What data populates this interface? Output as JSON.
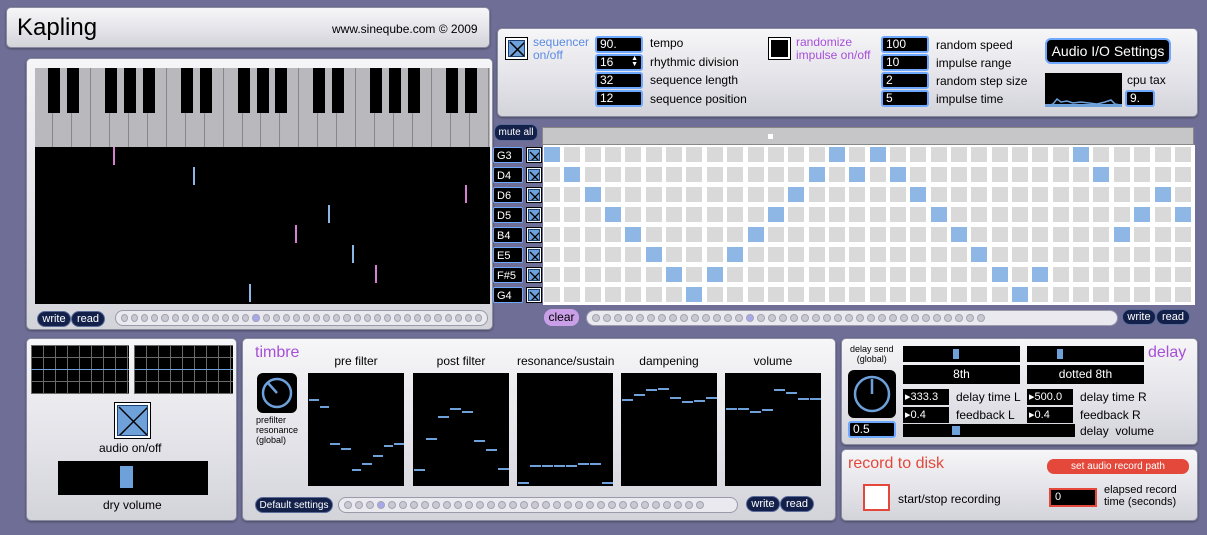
{
  "header": {
    "title": "Kapling",
    "credit": "www.sineqube.com © 2009"
  },
  "keyboard": {
    "white_keys": 24,
    "black_key_pattern": [
      1,
      1,
      0,
      1,
      1,
      1,
      0,
      1,
      1,
      0,
      1,
      1,
      1,
      0,
      1,
      1,
      0,
      1,
      1,
      1,
      0,
      1,
      1,
      0
    ],
    "write_label": "write",
    "read_label": "read",
    "preset_count": 36,
    "preset_selected": 13
  },
  "sequencer": {
    "toggle_label_line1": "sequencer",
    "toggle_label_line2": "on/off",
    "tempo_value": "90.",
    "tempo_label": "tempo",
    "division_value": "16",
    "division_label": "rhythmic division",
    "length_value": "32",
    "length_label": "sequence length",
    "position_value": "12",
    "position_label": "sequence position"
  },
  "randomize": {
    "toggle_label_line1": "randomize",
    "toggle_label_line2": "impulse on/off",
    "speed_value": "100",
    "speed_label": "random speed",
    "range_value": "10",
    "range_label": "impulse range",
    "step_value": "2",
    "step_label": "random step size",
    "time_value": "5",
    "time_label": "impulse time"
  },
  "audio_io": {
    "settings_label": "Audio I/O Settings",
    "cpu_label": "cpu tax",
    "cpu_value": "9."
  },
  "grid": {
    "mute_all_label": "mute all",
    "notes": [
      "G3",
      "D4",
      "D6",
      "D5",
      "B4",
      "E5",
      "F#5",
      "G4"
    ],
    "columns": 32,
    "active": [
      [
        0,
        14,
        16,
        26
      ],
      [
        1,
        13,
        15,
        17,
        27
      ],
      [
        2,
        12,
        18,
        30
      ],
      [
        3,
        11,
        19,
        29,
        31
      ],
      [
        4,
        10,
        20,
        28
      ],
      [
        5,
        9,
        21
      ],
      [
        6,
        8,
        22,
        24
      ],
      [
        7,
        23
      ]
    ],
    "clear_label": "clear",
    "write_label": "write",
    "read_label": "read",
    "preset_count": 36,
    "preset_selected": 14
  },
  "audio": {
    "onoff_label": "audio on/off",
    "dry_volume_label": "dry volume",
    "dry_volume_level": 0.45
  },
  "timbre": {
    "title": "timbre",
    "prefilter_label_line1": "prefilter",
    "prefilter_label_line2": "resonance",
    "prefilter_label_line3": "(global)",
    "graphs": [
      {
        "label": "pre filter",
        "levels": [
          0.78,
          0.72,
          0.38,
          0.33,
          0.14,
          0.19,
          0.27,
          0.36,
          0.38
        ]
      },
      {
        "label": "post filter",
        "levels": [
          0.14,
          0.42,
          0.62,
          0.7,
          0.67,
          0.4,
          0.32,
          0.15
        ]
      },
      {
        "label": "resonance/sustain",
        "levels": [
          0.02,
          0.17,
          0.17,
          0.17,
          0.17,
          0.19,
          0.19,
          0.02
        ]
      },
      {
        "label": "dampening",
        "levels": [
          0.78,
          0.83,
          0.87,
          0.88,
          0.8,
          0.76,
          0.77,
          0.8
        ]
      },
      {
        "label": "volume",
        "levels": [
          0.7,
          0.7,
          0.67,
          0.69,
          0.87,
          0.84,
          0.79,
          0.79
        ]
      }
    ],
    "default_settings_label": "Default settings",
    "write_label": "write",
    "read_label": "read",
    "preset_count": 33,
    "preset_selected": 3
  },
  "delay": {
    "title": "delay",
    "send_label_line1": "delay send",
    "send_label_line2": "(global)",
    "send_value": "0.5",
    "division_L": "8th",
    "division_R": "dotted 8th",
    "time_L_value": "333.3",
    "time_L_label": "delay time L",
    "time_R_value": "500.0",
    "time_R_label": "delay time R",
    "feedback_L_value": "0.4",
    "feedback_L_label": "feedback L",
    "feedback_R_value": "0.4",
    "feedback_R_label": "feedback R",
    "volume_label": "delay  volume",
    "slider_L_level": 0.45,
    "slider_R_level": 0.27,
    "volume_level": 0.3
  },
  "record": {
    "title": "record to disk",
    "set_path_label": "set audio record path",
    "start_stop_label": "start/stop recording",
    "elapsed_value": "0",
    "elapsed_label_line1": "elapsed record",
    "elapsed_label_line2": "time (seconds)"
  },
  "colors": {
    "accent": "#a64fd9",
    "record_red": "#e3483b",
    "blue": "#6ea0da",
    "background": "#6e6e96"
  }
}
